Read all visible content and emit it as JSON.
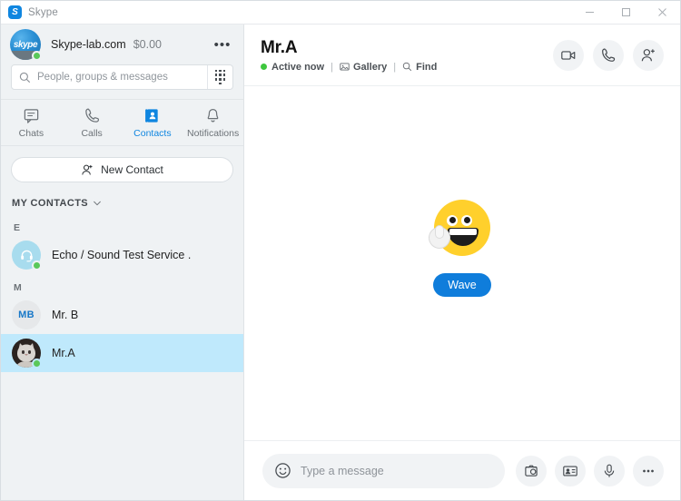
{
  "window": {
    "title": "Skype",
    "app_icon": "skype-logo-icon",
    "minimize_label": "Minimize",
    "maximize_label": "Maximize",
    "close_label": "Close"
  },
  "sidebar": {
    "profile": {
      "name": "Skype-lab.com",
      "balance": "$0.00",
      "status": "online",
      "avatar_text": "skype",
      "more_label": "•••"
    },
    "search": {
      "placeholder": "People, groups & messages",
      "value": "",
      "icon": "search-icon",
      "dialpad_icon": "dialpad-icon"
    },
    "tabs": [
      {
        "label": "Chats",
        "icon": "chat-icon",
        "active": false
      },
      {
        "label": "Calls",
        "icon": "phone-icon",
        "active": false
      },
      {
        "label": "Contacts",
        "icon": "contacts-book-icon",
        "active": true
      },
      {
        "label": "Notifications",
        "icon": "bell-icon",
        "active": false
      }
    ],
    "new_contact": {
      "label": "New Contact",
      "icon": "add-person-icon"
    },
    "section_title": "MY CONTACTS",
    "groups": [
      {
        "letter": "E",
        "contacts": [
          {
            "name": "Echo / Sound Test Service .",
            "avatar_type": "echo",
            "status": "online",
            "selected": false
          }
        ]
      },
      {
        "letter": "M",
        "contacts": [
          {
            "name": "Mr. B",
            "avatar_type": "initials",
            "initials": "MB",
            "status": "none",
            "selected": false
          },
          {
            "name": "Mr.A",
            "avatar_type": "photo",
            "status": "online",
            "selected": true
          }
        ]
      }
    ]
  },
  "chat": {
    "header": {
      "title": "Mr.A",
      "status": "Active now",
      "gallery": "Gallery",
      "find": "Find",
      "separator": "|",
      "actions": [
        {
          "name": "video-call-button",
          "icon": "video-camera-icon",
          "highlighted": false
        },
        {
          "name": "audio-call-button",
          "icon": "phone-icon",
          "highlighted": true
        },
        {
          "name": "add-people-button",
          "icon": "add-person-icon",
          "highlighted": false
        }
      ],
      "highlight_color": "#fc0d1b"
    },
    "empty_state": {
      "emoji": "waving-smiley-emoji",
      "wave_button": "Wave",
      "wave_color": "#0f7ddb"
    },
    "composer": {
      "placeholder": "Type a message",
      "value": "",
      "emoji_icon": "smiley-icon",
      "actions": [
        {
          "name": "send-image-button",
          "icon": "image-icon"
        },
        {
          "name": "send-contact-button",
          "icon": "contact-card-icon"
        },
        {
          "name": "record-audio-button",
          "icon": "microphone-icon"
        },
        {
          "name": "more-options-button",
          "icon": "ellipsis-icon"
        }
      ]
    }
  }
}
